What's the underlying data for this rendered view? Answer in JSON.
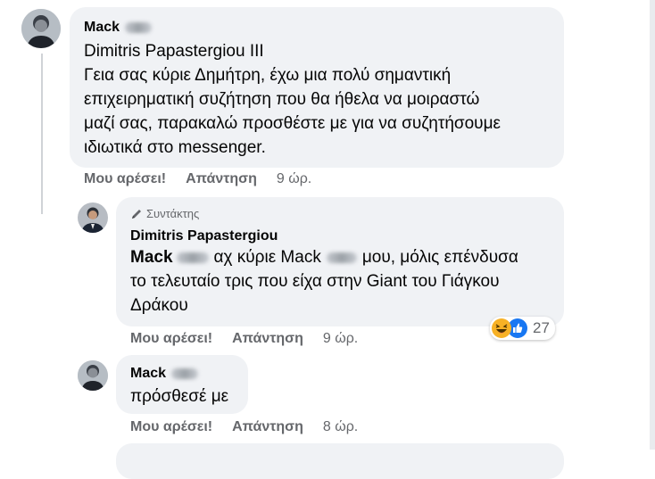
{
  "comments": [
    {
      "author": "Mack",
      "lines": [
        "Dimitris Papastergiou III",
        "Γεια σας κύριε Δημήτρη, έχω μια πολύ σημαντική",
        "επιχειρηματική συζήτηση που θα ήθελα να μοιραστώ",
        "μαζί σας, παρακαλώ προσθέστε με για να συζητήσουμε",
        "ιδιωτικά στο messenger."
      ],
      "like_label": "Μου αρέσει!",
      "reply_label": "Απάντηση",
      "time": "9 ώρ."
    },
    {
      "author_badge": "Συντάκτης",
      "author": "Dimitris Papastergiou",
      "mention": "Mack",
      "line1_a": "αχ κύριε Mack",
      "line1_b": "μου, μόλις επένδυσα",
      "line2": "το τελευταίο τρις που είχα στην Giant του Γιάγκου",
      "line3": "Δράκου",
      "reaction_count": "27",
      "reaction_icons": [
        "laughing-emoji-icon",
        "like-thumb-icon"
      ],
      "like_label": "Μου αρέσει!",
      "reply_label": "Απάντηση",
      "time": "9 ώρ."
    },
    {
      "author": "Mack",
      "text": "πρόσθεσέ με",
      "like_label": "Μου αρέσει!",
      "reply_label": "Απάντηση",
      "time": "8 ώρ."
    }
  ],
  "colors": {
    "bubble": "#f0f2f5",
    "secondary_text": "#65676b",
    "like_blue": "#1877f2",
    "haha_yellow": "#f7b125"
  }
}
